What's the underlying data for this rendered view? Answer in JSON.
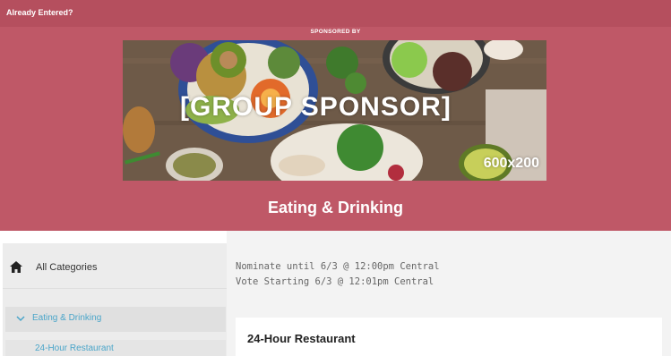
{
  "header": {
    "already_entered": "Already Entered?",
    "sponsored_by": "SPONSORED BY",
    "category_title": "Eating & Drinking"
  },
  "banner": {
    "label": "[GROUP SPONSOR]",
    "size": "600x200"
  },
  "sidebar": {
    "all_categories": "All Categories",
    "active_category": "Eating & Drinking",
    "sub_item": "24-Hour Restaurant"
  },
  "main": {
    "nominate_text": "Nominate until 6/3 @ 12:00pm Central",
    "vote_text": "Vote Starting 6/3 @ 12:01pm Central",
    "card_title": "24-Hour Restaurant"
  },
  "colors": {
    "brand": "#bf5867",
    "link": "#4aa5c9"
  },
  "icons": {
    "home": "home-icon",
    "chevron": "chevron-down-icon"
  }
}
